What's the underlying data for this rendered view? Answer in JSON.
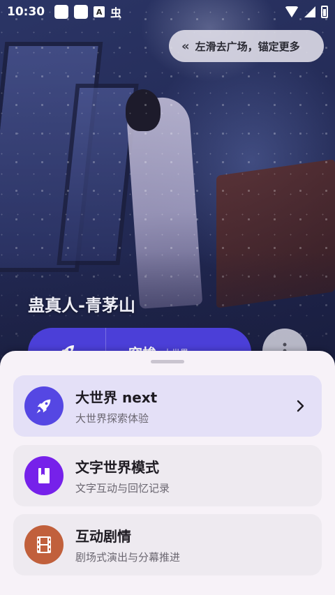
{
  "status_bar": {
    "time": "10:30",
    "icons": [
      "notification-square-icon",
      "notification-square-icon",
      "keyboard-a-icon",
      "bug-icon",
      "wifi-icon",
      "signal-icon",
      "battery-icon"
    ]
  },
  "swipe_hint": {
    "icon": "double-chevron-left-icon",
    "label": "左滑去广场，锚定更多"
  },
  "character": {
    "title": "蛊真人-青茅山"
  },
  "action_bar": {
    "rocket_icon": "rocket-icon",
    "main_label": "穿梭",
    "sub_label": "大世界",
    "more_icon": "more-vertical-icon"
  },
  "mode_sheet": {
    "options": [
      {
        "title": "大世界 next",
        "subtitle": "大世界探索体验",
        "icon": "rocket-icon",
        "icon_bg": "#5547e3",
        "selected": true,
        "has_chevron": true
      },
      {
        "title": "文字世界模式",
        "subtitle": "文字互动与回忆记录",
        "icon": "book-icon",
        "icon_bg": "#7621ea",
        "selected": false,
        "has_chevron": false
      },
      {
        "title": "互动剧情",
        "subtitle": "剧场式演出与分幕推进",
        "icon": "film-icon",
        "icon_bg": "#c1603c",
        "selected": false,
        "has_chevron": false
      }
    ]
  }
}
